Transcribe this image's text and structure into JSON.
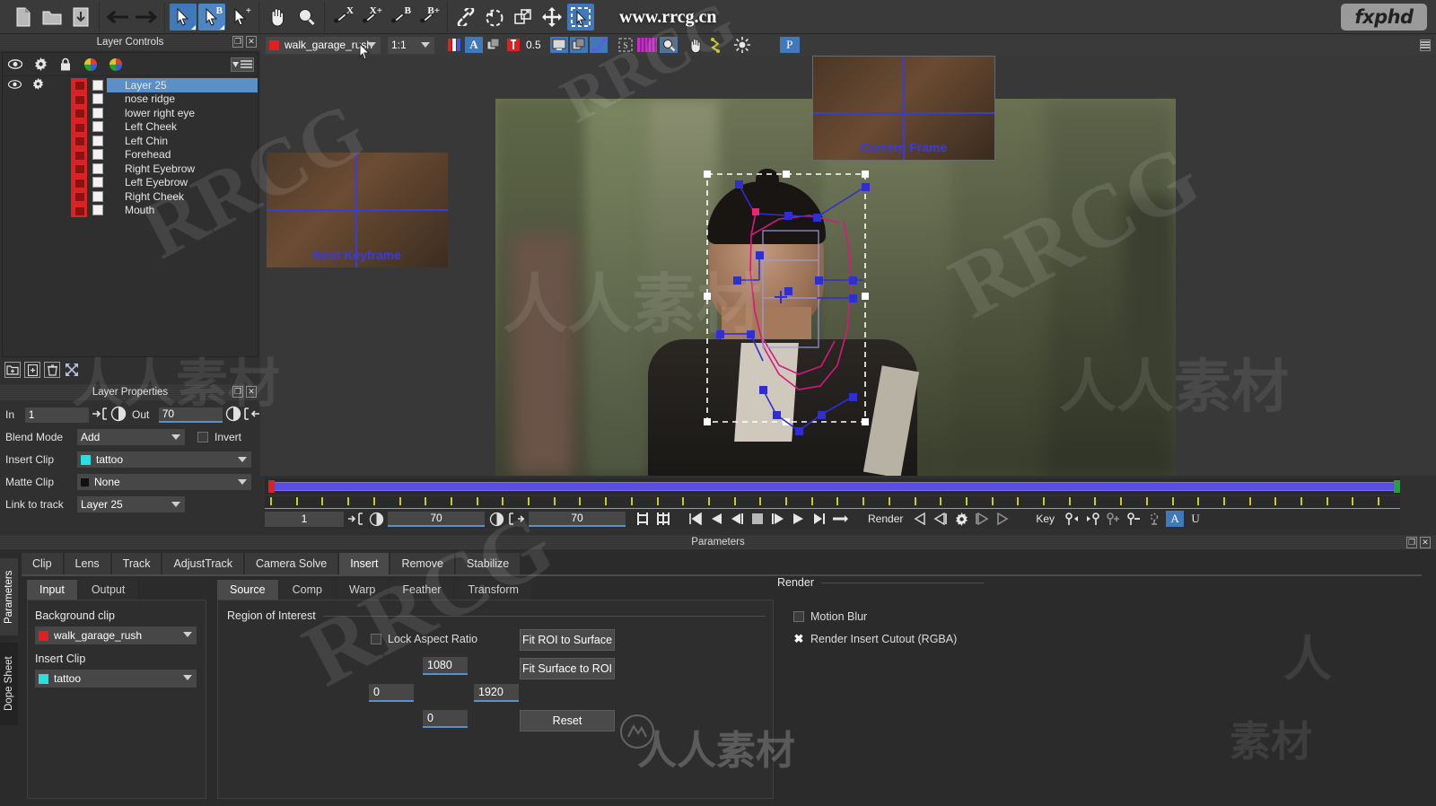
{
  "app": {
    "brand_logo": "fxphd",
    "watermark_url": "www.rrcg.cn",
    "watermarks": [
      "RRCG",
      "人人素材"
    ]
  },
  "toolbar": {
    "groups": [
      {
        "name": "file",
        "buttons": [
          {
            "icon": "new-document-icon",
            "label": "New"
          },
          {
            "icon": "open-folder-icon",
            "label": "Open"
          },
          {
            "icon": "save-icon",
            "label": "Save"
          }
        ]
      },
      {
        "name": "history",
        "buttons": [
          {
            "icon": "arrow-left-icon",
            "label": "Undo"
          },
          {
            "icon": "arrow-right-icon",
            "label": "Redo"
          }
        ]
      },
      {
        "name": "select",
        "buttons": [
          {
            "icon": "select-arrow-icon",
            "label": "Select",
            "selected": true
          },
          {
            "icon": "select-arrow-b-icon",
            "label": "Select B",
            "selected": true,
            "sup": "B"
          },
          {
            "icon": "select-arrow-plus-icon",
            "label": "Add Point",
            "sup": "+"
          }
        ]
      },
      {
        "name": "navigate",
        "buttons": [
          {
            "icon": "pan-hand-icon",
            "label": "Pan"
          },
          {
            "icon": "magnifier-icon",
            "label": "Zoom"
          }
        ]
      },
      {
        "name": "spline",
        "buttons": [
          {
            "icon": "pen-x-icon",
            "label": "X Spline",
            "sup": "X"
          },
          {
            "icon": "pen-x-plus-icon",
            "label": "X Spline Add",
            "sup": "X+"
          },
          {
            "icon": "pen-b-icon",
            "label": "B Spline",
            "sup": "B"
          },
          {
            "icon": "pen-b-plus-icon",
            "label": "B Spline Add",
            "sup": "B+"
          }
        ]
      },
      {
        "name": "tools",
        "buttons": [
          {
            "icon": "link-chain-icon",
            "label": "Link"
          },
          {
            "icon": "rotate-dashed-icon",
            "label": "Rotate"
          },
          {
            "icon": "duplicate-shape-icon",
            "label": "Duplicate"
          },
          {
            "icon": "move-cross-icon",
            "label": "Move"
          },
          {
            "icon": "marquee-select-icon",
            "label": "Marquee",
            "selected": true
          }
        ]
      }
    ]
  },
  "viewer_toolbar": {
    "clip_name": "walk_garage_rush",
    "clip_color": "#e02020",
    "zoom_level": "1:1",
    "opacity_value": "0.5",
    "buttons": [
      {
        "icon": "rgb-channels-icon",
        "label": "RGB Channels"
      },
      {
        "icon": "alpha-channel-icon",
        "label": "Alpha",
        "selected": true
      },
      {
        "icon": "layers-icon",
        "label": "Overlay"
      },
      {
        "icon": "matte-icon",
        "label": "Matte"
      },
      {
        "icon": "monitor-icon",
        "label": "Monitor Out"
      },
      {
        "icon": "multi-view-icon",
        "label": "Multi View",
        "selected": true
      },
      {
        "icon": "curve-icon",
        "label": "Curves"
      },
      {
        "icon": "surface-icon",
        "label": "Surface"
      },
      {
        "icon": "grid-magenta-icon",
        "label": "Grid"
      },
      {
        "icon": "zoom-region-icon",
        "label": "Zoom Region",
        "selected": true
      },
      {
        "icon": "hand-icon",
        "label": "Pan View"
      },
      {
        "icon": "bone-icon",
        "label": "Planar Track"
      },
      {
        "icon": "brightness-icon",
        "label": "Brightness"
      },
      {
        "icon": "proxy-p-icon",
        "label": "Proxy",
        "selected": true
      }
    ]
  },
  "layer_controls": {
    "title": "Layer Controls",
    "header_icons": [
      "eye-icon",
      "gear-icon",
      "lock-icon",
      "color-wheel-icon",
      "color-wheel-2-icon",
      "menu-icon"
    ],
    "layers": [
      {
        "name": "Layer 25",
        "selected": true
      },
      {
        "name": "nose ridge",
        "selected": false
      },
      {
        "name": "lower right eye",
        "selected": false
      },
      {
        "name": "Left Cheek",
        "selected": false
      },
      {
        "name": "Left Chin",
        "selected": false
      },
      {
        "name": "Forehead",
        "selected": false
      },
      {
        "name": "Right Eyebrow",
        "selected": false
      },
      {
        "name": "Left Eyebrow",
        "selected": false
      },
      {
        "name": "Right Cheek",
        "selected": false
      },
      {
        "name": "Mouth",
        "selected": false
      }
    ],
    "bottom_buttons": [
      {
        "icon": "new-group-icon",
        "label": "New Group"
      },
      {
        "icon": "new-layer-icon",
        "label": "New Layer"
      },
      {
        "icon": "trash-icon",
        "label": "Delete Layer"
      },
      {
        "icon": "expand-icon",
        "label": "Expand"
      }
    ]
  },
  "layer_properties": {
    "title": "Layer Properties",
    "in_label": "In",
    "in_value": "1",
    "out_label": "Out",
    "out_value": "70",
    "blend_mode_label": "Blend Mode",
    "blend_mode_value": "Add",
    "invert_label": "Invert",
    "invert_checked": false,
    "insert_clip_label": "Insert Clip",
    "insert_clip_value": "tattoo",
    "insert_clip_color": "#29e0e0",
    "matte_clip_label": "Matte Clip",
    "matte_clip_value": "None",
    "matte_clip_color": "#111111",
    "link_to_track_label": "Link to track",
    "link_to_track_value": "Layer 25"
  },
  "viewer": {
    "thumbnail_next_keyframe_label": "Next Keyframe",
    "thumbnail_current_frame_label": "Current Frame"
  },
  "timeline": {
    "current_frame": "1",
    "in_point": "70",
    "out_point": "70",
    "render_label": "Render",
    "key_label": "Key",
    "transport_buttons": [
      {
        "icon": "go-to-start-icon",
        "label": "Go to Start"
      },
      {
        "icon": "play-backward-icon",
        "label": "Play Backward"
      },
      {
        "icon": "step-backward-icon",
        "label": "Step Backward"
      },
      {
        "icon": "stop-icon",
        "label": "Stop"
      },
      {
        "icon": "step-forward-icon",
        "label": "Step Forward"
      },
      {
        "icon": "play-forward-icon",
        "label": "Play Forward"
      },
      {
        "icon": "go-to-end-icon",
        "label": "Go to End"
      },
      {
        "icon": "loop-icon",
        "label": "Loop"
      }
    ],
    "render_buttons": [
      {
        "icon": "render-prev-icon",
        "label": "Render Previous"
      },
      {
        "icon": "render-step-prev-icon",
        "label": "Render Step Back"
      },
      {
        "icon": "render-settings-icon",
        "label": "Render Settings"
      },
      {
        "icon": "render-step-next-icon",
        "label": "Render Step Fwd"
      },
      {
        "icon": "render-next-icon",
        "label": "Render Next"
      }
    ],
    "key_buttons": [
      {
        "icon": "prev-key-icon",
        "label": "Previous Key"
      },
      {
        "icon": "next-key-icon",
        "label": "Next Key"
      },
      {
        "icon": "add-key-icon",
        "label": "Add Key"
      },
      {
        "icon": "remove-key-icon",
        "label": "Remove Key"
      },
      {
        "icon": "key-settings-icon",
        "label": "Key Settings"
      },
      {
        "icon": "auto-key-a-icon",
        "label": "Auto Key",
        "selected": true
      },
      {
        "icon": "key-u-icon",
        "label": "Key U"
      }
    ]
  },
  "parameters": {
    "panel_title": "Parameters",
    "vertical_tabs": [
      {
        "label": "Parameters",
        "selected": true
      },
      {
        "label": "Dope Sheet",
        "selected": false
      }
    ],
    "module_tabs": [
      {
        "label": "Clip",
        "selected": false
      },
      {
        "label": "Lens",
        "selected": false
      },
      {
        "label": "Track",
        "selected": false
      },
      {
        "label": "AdjustTrack",
        "selected": false
      },
      {
        "label": "Camera Solve",
        "selected": false
      },
      {
        "label": "Insert",
        "selected": true
      },
      {
        "label": "Remove",
        "selected": false
      },
      {
        "label": "Stabilize",
        "selected": false
      }
    ],
    "io_tabs": [
      {
        "label": "Input",
        "selected": true
      },
      {
        "label": "Output",
        "selected": false
      }
    ],
    "input": {
      "background_clip_label": "Background clip",
      "background_clip_value": "walk_garage_rush",
      "background_clip_color": "#e02020",
      "insert_clip_label": "Insert Clip",
      "insert_clip_value": "tattoo",
      "insert_clip_color": "#29e0e0"
    },
    "source_tabs": [
      {
        "label": "Source",
        "selected": true
      },
      {
        "label": "Comp",
        "selected": false
      },
      {
        "label": "Warp",
        "selected": false
      },
      {
        "label": "Feather",
        "selected": false
      },
      {
        "label": "Transform",
        "selected": false
      }
    ],
    "roi": {
      "title": "Region of Interest",
      "lock_aspect_label": "Lock Aspect Ratio",
      "lock_aspect_checked": false,
      "top_value": "1080",
      "left_value": "0",
      "right_value": "1920",
      "bottom_value": "0",
      "fit_roi_to_surface": "Fit ROI to Surface",
      "fit_surface_to_roi": "Fit Surface to ROI",
      "reset": "Reset"
    },
    "render": {
      "title": "Render",
      "motion_blur_label": "Motion Blur",
      "motion_blur_checked": false,
      "render_insert_cutout_label": "Render Insert Cutout (RGBA)",
      "render_insert_cutout_checked": true
    }
  }
}
